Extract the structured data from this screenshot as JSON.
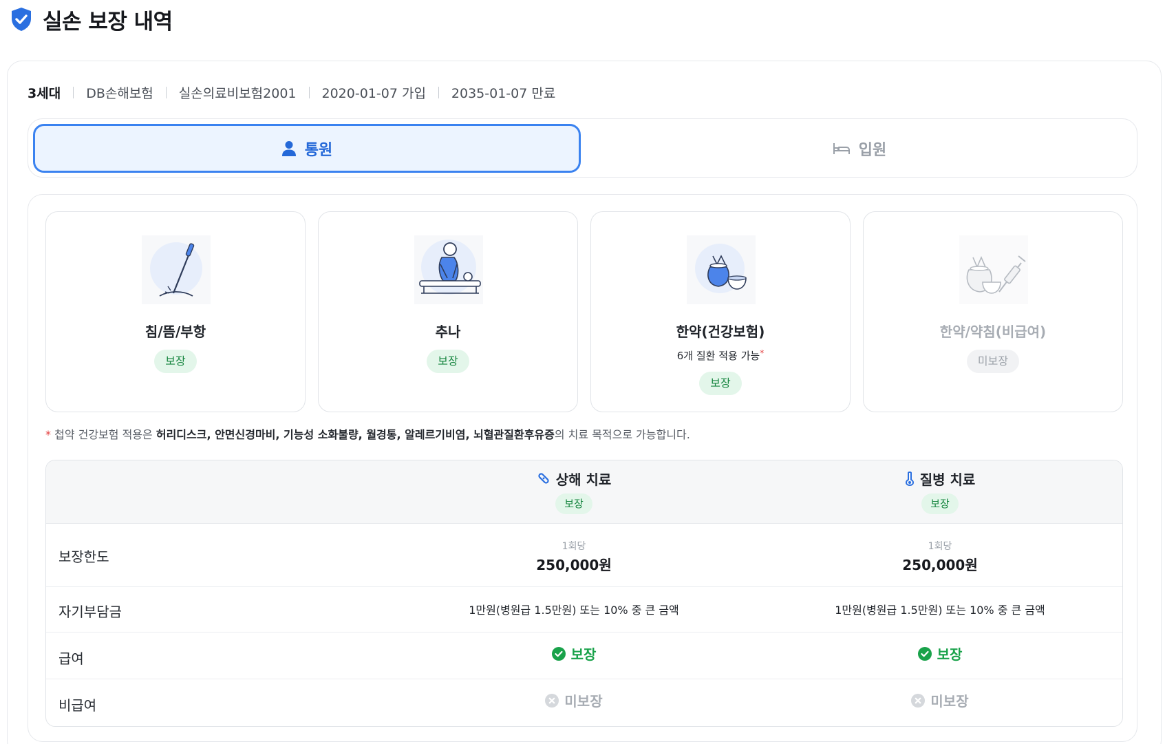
{
  "page": {
    "title": "실손 보장 내역"
  },
  "policy": {
    "generation": "3세대",
    "insurer": "DB손해보험",
    "product": "실손의료비보험2001",
    "join_date": "2020-01-07 가입",
    "expire_date": "2035-01-07 만료"
  },
  "tabs": [
    {
      "label": "통원",
      "icon": "person-icon",
      "active": true
    },
    {
      "label": "입원",
      "icon": "bed-icon",
      "active": false
    }
  ],
  "treatments": [
    {
      "name": "침/뜸/부항",
      "sub": "",
      "status": "보장",
      "icon": "acupuncture-needle-icon"
    },
    {
      "name": "추나",
      "sub": "",
      "status": "보장",
      "icon": "chuna-massage-icon"
    },
    {
      "name": "한약(건강보험)",
      "sub": "6개 질환 적용 가능",
      "sub_mark": "*",
      "status": "보장",
      "icon": "herbal-medicine-bag-icon"
    },
    {
      "name": "한약/약침(비급여)",
      "sub": "",
      "status": "미보장",
      "icon": "herbal-injection-icon"
    }
  ],
  "footnote": {
    "mark": "*",
    "prefix": "첩약 건강보험 적용은",
    "diseases": "허리디스크, 안면신경마비, 기능성 소화불량, 월경통, 알레르기비염, 뇌혈관질환후유증",
    "suffix": "의 치료 목적으로 가능합니다."
  },
  "table": {
    "columns": [
      {
        "label": "상해 치료",
        "icon": "bandage-icon",
        "badge": "보장"
      },
      {
        "label": "질병 치료",
        "icon": "thermometer-icon",
        "badge": "보장"
      }
    ],
    "rows": {
      "limit": {
        "label": "보장한도",
        "per": "1회당",
        "values": [
          "250,000원",
          "250,000원"
        ]
      },
      "deductible": {
        "label": "자기부담금",
        "values": [
          "1만원(병원급 1.5만원) 또는 10% 중 큰 금액",
          "1만원(병원급 1.5만원) 또는 10% 중 큰 금액"
        ]
      },
      "covered": {
        "label": "급여",
        "values": [
          "보장",
          "보장"
        ]
      },
      "noncovered": {
        "label": "비급여",
        "values": [
          "미보장",
          "미보장"
        ]
      }
    }
  },
  "colors": {
    "accent": "#3a82f0",
    "covered_green": "#19a24a",
    "badge_green_bg": "#e3f6ea",
    "muted": "#a7acb3"
  }
}
